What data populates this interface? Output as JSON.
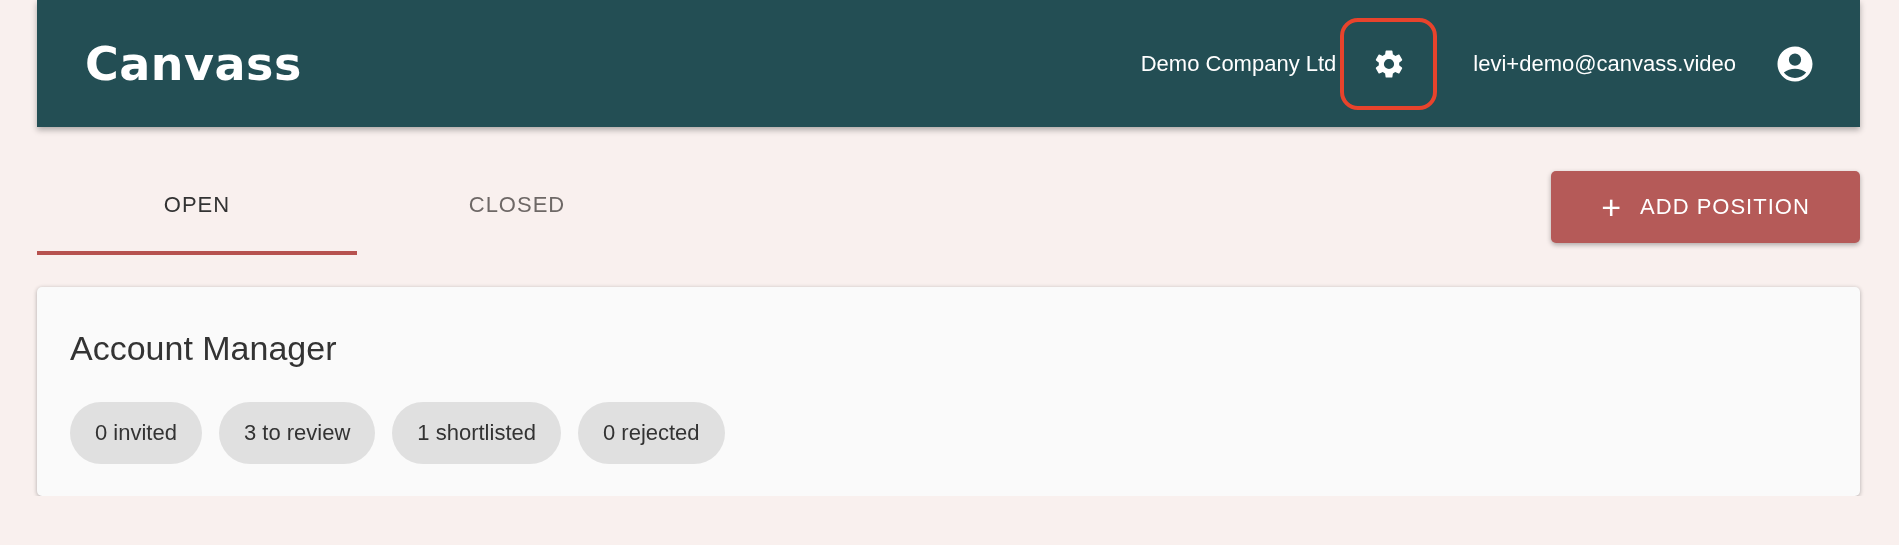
{
  "header": {
    "logo": "Canvass",
    "company": "Demo Company Ltd",
    "settings": {
      "highlighted": true
    },
    "email": "levi+demo@canvass.video"
  },
  "tabs": [
    {
      "label": "OPEN",
      "selected": true
    },
    {
      "label": "CLOSED",
      "selected": false
    }
  ],
  "add_button": {
    "icon": "+",
    "label": "ADD POSITION"
  },
  "positions": [
    {
      "title": "Account Manager",
      "chips": [
        "0 invited",
        "3 to review",
        "1 shortlisted",
        "0 rejected"
      ]
    }
  ]
}
